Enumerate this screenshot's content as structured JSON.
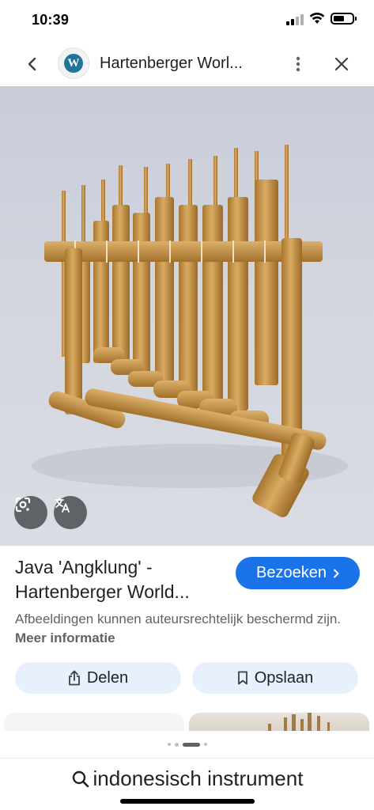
{
  "status_bar": {
    "time": "10:39",
    "icons": [
      "cellular-signal-icon",
      "wifi-icon",
      "battery-icon"
    ]
  },
  "header": {
    "title": "Hartenberger Worl...",
    "site_icon": "wordpress-icon",
    "site_icon_letter": "W",
    "icons": [
      "back-arrow-icon",
      "more-vert-icon",
      "close-icon"
    ]
  },
  "image": {
    "subject": "photo",
    "overlay_buttons": [
      "google-lens-icon",
      "translate-icon"
    ]
  },
  "result": {
    "title": "Java 'Angklung' - Hartenberger World...",
    "visit_label": "Bezoeken",
    "copyright_text": "Afbeeldingen kunnen auteursrechtelijk beschermd zijn.",
    "more_info_label": "Meer informatie"
  },
  "actions": {
    "share_label": "Delen",
    "save_label": "Opslaan"
  },
  "pager": {
    "count": 4,
    "active_index": 2
  },
  "search": {
    "query": "indonesisch instrument"
  },
  "colors": {
    "accent": "#1a73e8",
    "action_bg": "#e8f0fe",
    "muted_text": "#5f6368",
    "title_text": "#202124"
  }
}
